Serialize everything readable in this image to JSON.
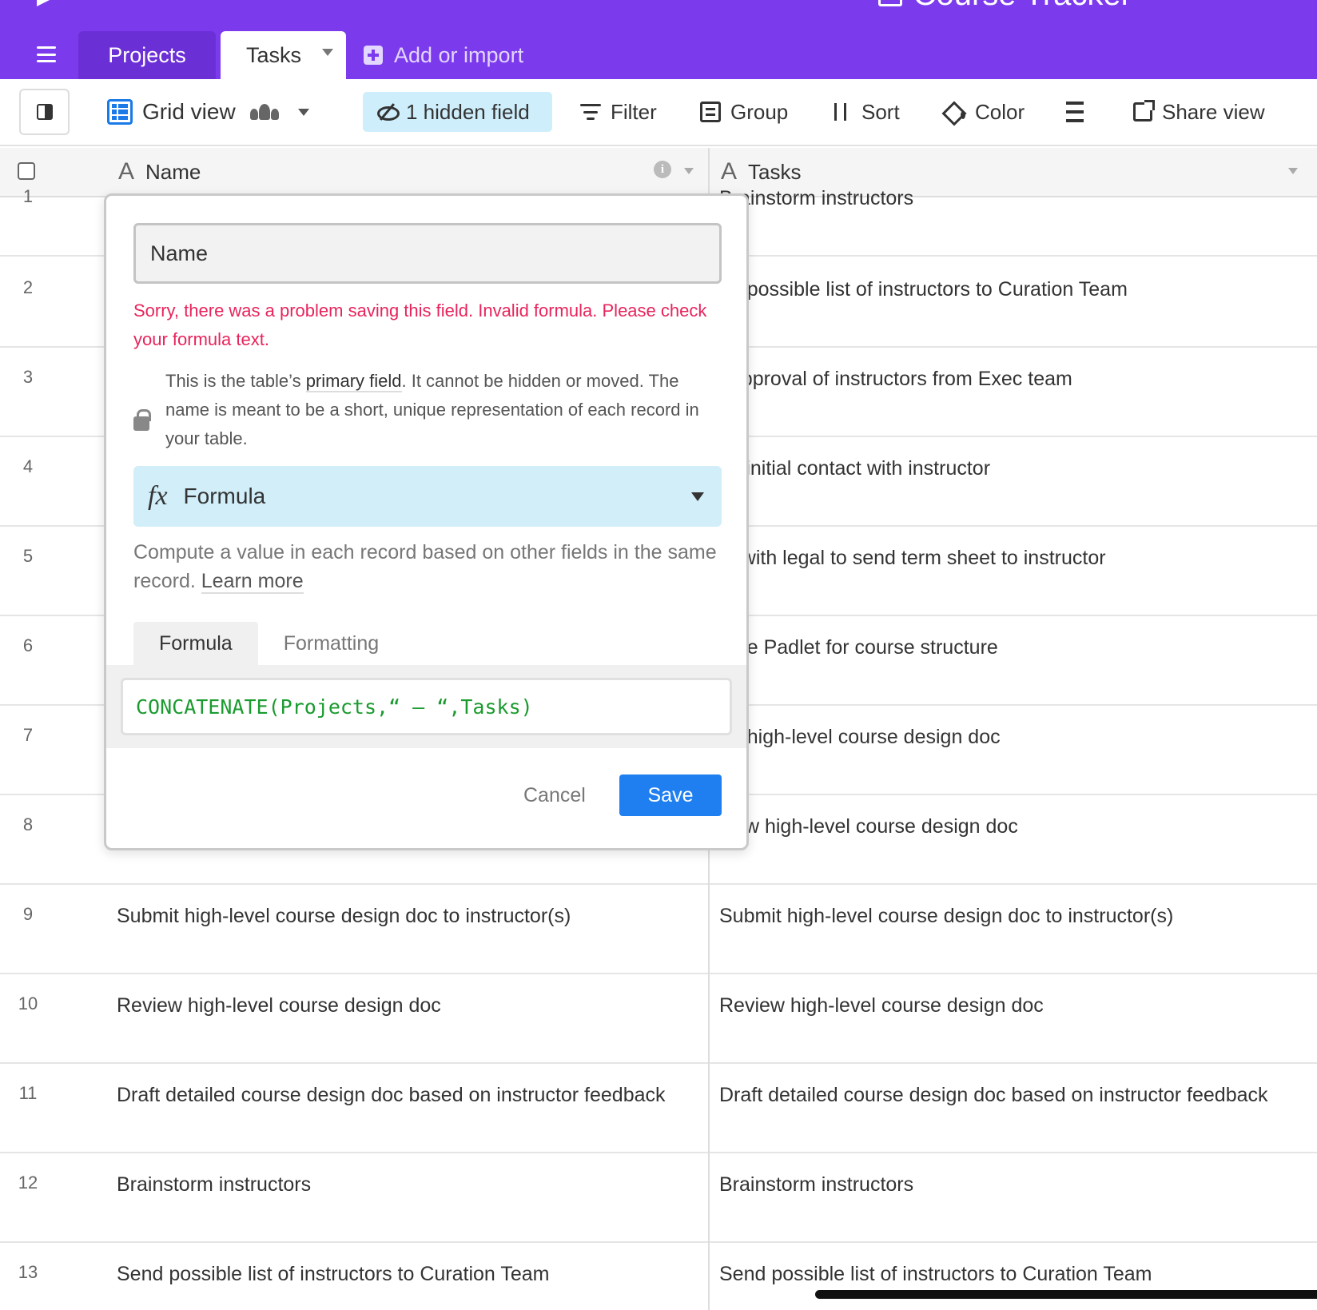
{
  "app": {
    "base_title": "Course Tracker",
    "accent_color": "#7c3aed"
  },
  "tabs": [
    {
      "label": "Projects"
    },
    {
      "label": "Tasks"
    }
  ],
  "add_import_label": "Add or import",
  "toolbar": {
    "view_name": "Grid view",
    "hidden_fields_label": "1 hidden field",
    "filter_label": "Filter",
    "group_label": "Group",
    "sort_label": "Sort",
    "color_label": "Color",
    "share_label": "Share view"
  },
  "columns": {
    "name": "Name",
    "tasks": "Tasks"
  },
  "rows": [
    {
      "num": "1",
      "name": "",
      "tasks": "Brainstorm instructors"
    },
    {
      "num": "2",
      "name": "",
      "tasks": "nd possible list of instructors to Curation Team"
    },
    {
      "num": "3",
      "name": "",
      "tasks": "t approval of instructors from Exec team"
    },
    {
      "num": "4",
      "name": "",
      "tasks": "ke initial contact with instructor"
    },
    {
      "num": "5",
      "name": "",
      "tasks": "rk with legal to send term sheet to instructor"
    },
    {
      "num": "6",
      "name": "",
      "tasks": "eate Padlet for course structure"
    },
    {
      "num": "7",
      "name": "",
      "tasks": "aft high-level course design doc"
    },
    {
      "num": "8",
      "name": "",
      "tasks": "view high-level course design doc"
    },
    {
      "num": "9",
      "name": "Submit high-level course design doc to instructor(s)",
      "tasks": "Submit high-level course design doc to instructor(s)"
    },
    {
      "num": "10",
      "name": "Review high-level course design doc",
      "tasks": "Review high-level course design doc"
    },
    {
      "num": "11",
      "name": "Draft detailed course design doc based on instructor feedback",
      "tasks": "Draft detailed course design doc based on instructor feedback"
    },
    {
      "num": "12",
      "name": "Brainstorm instructors",
      "tasks": "Brainstorm instructors"
    },
    {
      "num": "13",
      "name": "Send possible list of instructors to Curation Team",
      "tasks": "Send possible list of instructors to Curation Team"
    }
  ],
  "field_editor": {
    "field_name_value": "Name",
    "error_message": "Sorry, there was a problem saving this field. Invalid formula. Please check your formula text.",
    "primary_note_pre": "This is the table’s ",
    "primary_note_emph": "primary field",
    "primary_note_post": ". It cannot be hidden or moved. The name is meant to be a short, unique representation of each record in your table.",
    "field_type": "Formula",
    "type_description": "Compute a value in each record based on other fields in the same record.",
    "learn_more": "Learn more",
    "tab_formula": "Formula",
    "tab_formatting": "Formatting",
    "formula_text": "CONCATENATE(Projects,“ – “,Tasks)",
    "cancel_label": "Cancel",
    "save_label": "Save",
    "save_color": "#1f7ff0",
    "error_color": "#e8245c"
  }
}
